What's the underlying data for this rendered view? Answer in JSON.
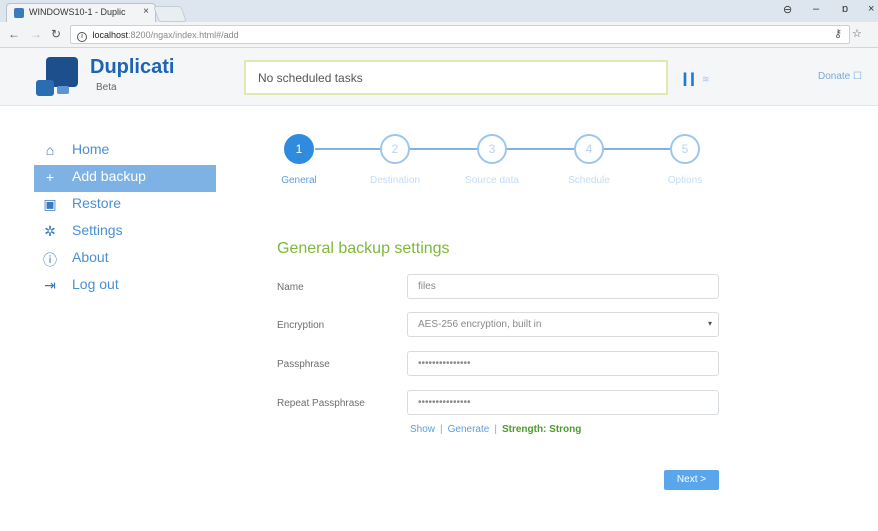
{
  "browser": {
    "tab_title": "WINDOWS10-1 - Duplic",
    "tab_close": "×",
    "url_host": "localhost",
    "url_path": ":8200/ngax/index.html#/add",
    "window_controls": [
      "⊖",
      "–",
      "ɒ",
      "×"
    ]
  },
  "header": {
    "brand": "Duplicati",
    "brand_sub": "Beta",
    "status": "No scheduled tasks",
    "donate": "Donate ☐"
  },
  "sidebar": {
    "items": [
      {
        "label": "Home",
        "icon": "home-icon"
      },
      {
        "label": "Add backup",
        "icon": "plus-icon"
      },
      {
        "label": "Restore",
        "icon": "restore-icon"
      },
      {
        "label": "Settings",
        "icon": "gear-icon"
      },
      {
        "label": "About",
        "icon": "info-icon"
      },
      {
        "label": "Log out",
        "icon": "logout-icon"
      }
    ]
  },
  "stepper": {
    "steps": [
      {
        "number": "1",
        "label": "General"
      },
      {
        "number": "2",
        "label": "Destination"
      },
      {
        "number": "3",
        "label": "Source data"
      },
      {
        "number": "4",
        "label": "Schedule"
      },
      {
        "number": "5",
        "label": "Options"
      }
    ]
  },
  "form": {
    "title": "General backup settings",
    "name_label": "Name",
    "name_value": "files",
    "encryption_label": "Encryption",
    "encryption_value": "AES-256 encryption, built in",
    "passphrase_label": "Passphrase",
    "passphrase_value": "•••••••••••••••",
    "repeat_label": "Repeat Passphrase",
    "repeat_value": "•••••••••••••••",
    "show_link": "Show",
    "generate_link": "Generate",
    "strength_text": "Strength: Strong",
    "next_button": "Next >"
  },
  "colors": {
    "accent": "#2e8bde",
    "sidebar_active": "#7eb2e5",
    "title_green": "#7db93a",
    "strength_green": "#4f9a2f"
  }
}
